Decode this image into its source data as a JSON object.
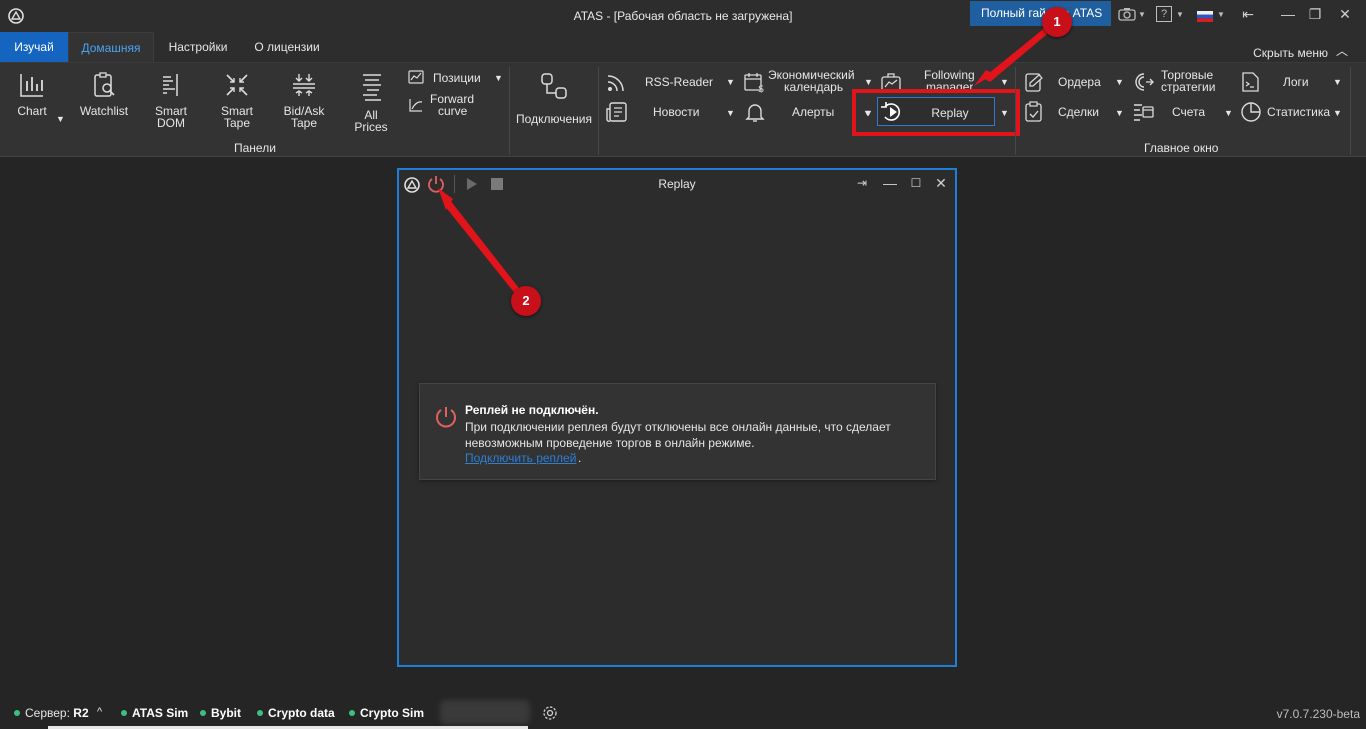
{
  "window": {
    "title": "ATAS - [Рабочая область не загружена]",
    "full_guide": "Полный гайд по ATAS",
    "help": "?",
    "language_flag": "ru"
  },
  "ribbon_tabs": {
    "learn": "Изучай",
    "home": "Домашняя",
    "settings": "Настройки",
    "license": "О лицензии",
    "hide_menu": "Скрыть меню"
  },
  "panels": {
    "chart": "Chart",
    "watchlist": "Watchlist",
    "smart_dom_1": "Smart",
    "smart_dom_2": "DOM",
    "smart_tape_1": "Smart",
    "smart_tape_2": "Tape",
    "bidask_tape_1": "Bid/Ask",
    "bidask_tape_2": "Tape",
    "all_prices_1": "All",
    "all_prices_2": "Prices",
    "positions": "Позиции",
    "forward_curve_1": "Forward",
    "forward_curve_2": "curve",
    "group_label": "Панели"
  },
  "connections": {
    "label": "Подключения"
  },
  "main_window": {
    "rss_reader": "RSS-Reader",
    "news": "Новости",
    "econ_cal_1": "Экономический",
    "econ_cal_2": "календарь",
    "alerts": "Алерты",
    "following_manager_1": "Following",
    "following_manager_2": "manager",
    "replay": "Replay",
    "orders": "Ордера",
    "deals": "Сделки",
    "strategies_1": "Торговые",
    "strategies_2": "стратегии",
    "accounts": "Счета",
    "logs": "Логи",
    "statistics": "Статистика",
    "group_label": "Главное окно"
  },
  "replay_window": {
    "title": "Replay",
    "notice_title": "Реплей не подключён.",
    "notice_line1": "При подключении реплея будут отключены все онлайн данные, что сделает",
    "notice_line2": "невозможным проведение торгов в онлайн режиме.",
    "notice_link": "Подключить реплей",
    "notice_link_suffix": "."
  },
  "status_bar": {
    "server_label": "Сервер:",
    "server_value": "R2",
    "conn1": "ATAS Sim",
    "conn2": "Bybit",
    "conn3": "Crypto data",
    "conn4": "Crypto Sim",
    "version": "v7.0.7.230-beta",
    "status_color": "#3fbf7f"
  },
  "annotations": {
    "marker1": "1",
    "marker2": "2",
    "color": "#e0141a"
  }
}
